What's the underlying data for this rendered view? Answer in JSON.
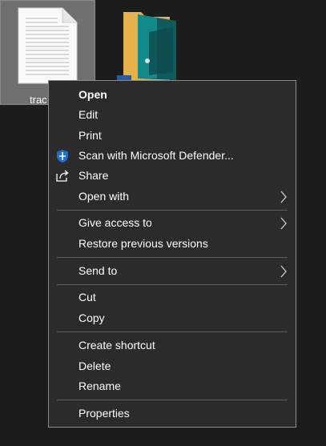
{
  "desktop": {
    "file_label": "trac"
  },
  "context_menu": {
    "open": "Open",
    "edit": "Edit",
    "print": "Print",
    "scan": "Scan with Microsoft Defender...",
    "share": "Share",
    "open_with": "Open with",
    "give_access": "Give access to",
    "restore": "Restore previous versions",
    "send_to": "Send to",
    "cut": "Cut",
    "copy": "Copy",
    "create_shortcut": "Create shortcut",
    "delete": "Delete",
    "rename": "Rename",
    "properties": "Properties"
  },
  "icons": {
    "scan": "defender-shield-icon",
    "share": "share-icon",
    "submenu": "chevron-right-icon"
  },
  "colors": {
    "menu_background": "#2b2b2b",
    "menu_border": "#8a8a8a",
    "separator": "#5a5a5a",
    "text": "#ffffff",
    "defender_blue": "#1f6fd0"
  }
}
